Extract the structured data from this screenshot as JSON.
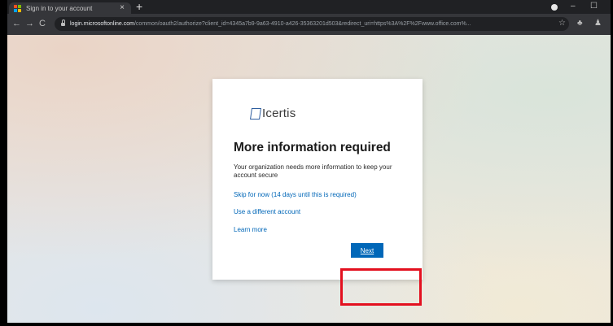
{
  "browser": {
    "tab_title": "Sign in to your account",
    "tab_close": "×",
    "new_tab": "+",
    "url_host": "login.microsoftonline.com",
    "url_rest": "/common/oauth2/authorize?client_id=4345a7b9-9a63-4910-a426-35363201d503&redirect_uri=https%3A%2F%2Fwww.office.com%...",
    "back": "←",
    "forward": "→",
    "reload": "C",
    "star": "☆",
    "extension": "♣",
    "account": "♟",
    "minimize": "–",
    "restore": "☐"
  },
  "card": {
    "logo_text": "Icertis",
    "heading": "More information required",
    "description": "Your organization needs more information to keep your account secure",
    "skip_link": "Skip for now (14 days until this is required)",
    "different_account_link": "Use a different account",
    "learn_more_link": "Learn more",
    "next_button": "Next"
  },
  "colors": {
    "microsoft_blue": "#0067b8",
    "highlight_red": "#e3101f",
    "favicon": [
      "#f25022",
      "#7fba00",
      "#00a4ef",
      "#ffb900"
    ]
  }
}
